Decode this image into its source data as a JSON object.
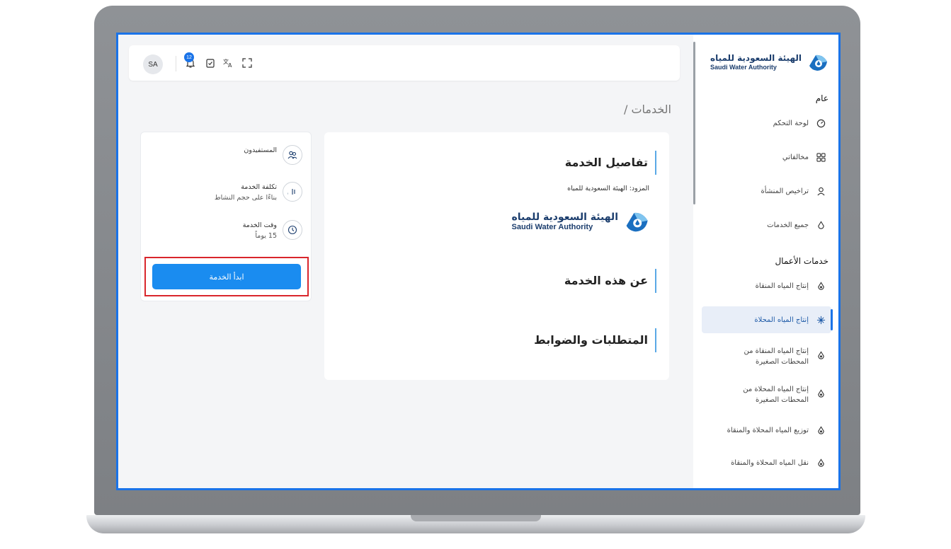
{
  "brand": {
    "name_ar": "الهيئة السعودية للمياه",
    "name_en": "Saudi Water Authority"
  },
  "sidebar": {
    "section_general": "عام",
    "general_items": [
      {
        "label": "لوحة التحكم",
        "icon": "dashboard-icon"
      },
      {
        "label": "مخالفاتي",
        "icon": "grid-icon"
      },
      {
        "label": "تراخيص المنشأة",
        "icon": "user-icon"
      },
      {
        "label": "جميع الخدمات",
        "icon": "drop-icon"
      }
    ],
    "section_business": "خدمات الأعمال",
    "business_items": [
      {
        "label": "إنتاج المياه المنقاة",
        "icon": "water-drop-icon"
      },
      {
        "label": "إنتاج المياه المحلاة",
        "icon": "desalination-icon",
        "active": true
      },
      {
        "label": "إنتاج المياه المنقاة من المحطات الصغيرة",
        "icon": "water-drop-icon"
      },
      {
        "label": "إنتاج المياه المحلاة من المحطات الصغيرة",
        "icon": "water-drop-icon"
      },
      {
        "label": "توزيع المياه المحلاة والمنقاة",
        "icon": "water-drop-icon"
      },
      {
        "label": "نقل المياه المحلاة والمنقاة",
        "icon": "water-drop-icon"
      }
    ]
  },
  "topbar": {
    "avatar": "SA",
    "notification_count": "12"
  },
  "breadcrumb": "الخدمات /",
  "main": {
    "details_title": "تفاصيل الخدمة",
    "provider": "المزود: الهيئة السعودية للمياه",
    "about_title": "عن هذه الخدمة",
    "requirements_title": "المتطلبات والضوابط"
  },
  "info": {
    "beneficiaries_label": "المستفيدون",
    "cost_label": "تكلفة الخدمة",
    "cost_value": "بناءًا على حجم النشاط",
    "time_label": "وقت الخدمة",
    "time_value": "15 يوماً",
    "start_button": "ابدأ الخدمة"
  },
  "colors": {
    "accent": "#1a8cf0",
    "highlight": "#d9262c",
    "brand": "#1b3d6d"
  }
}
